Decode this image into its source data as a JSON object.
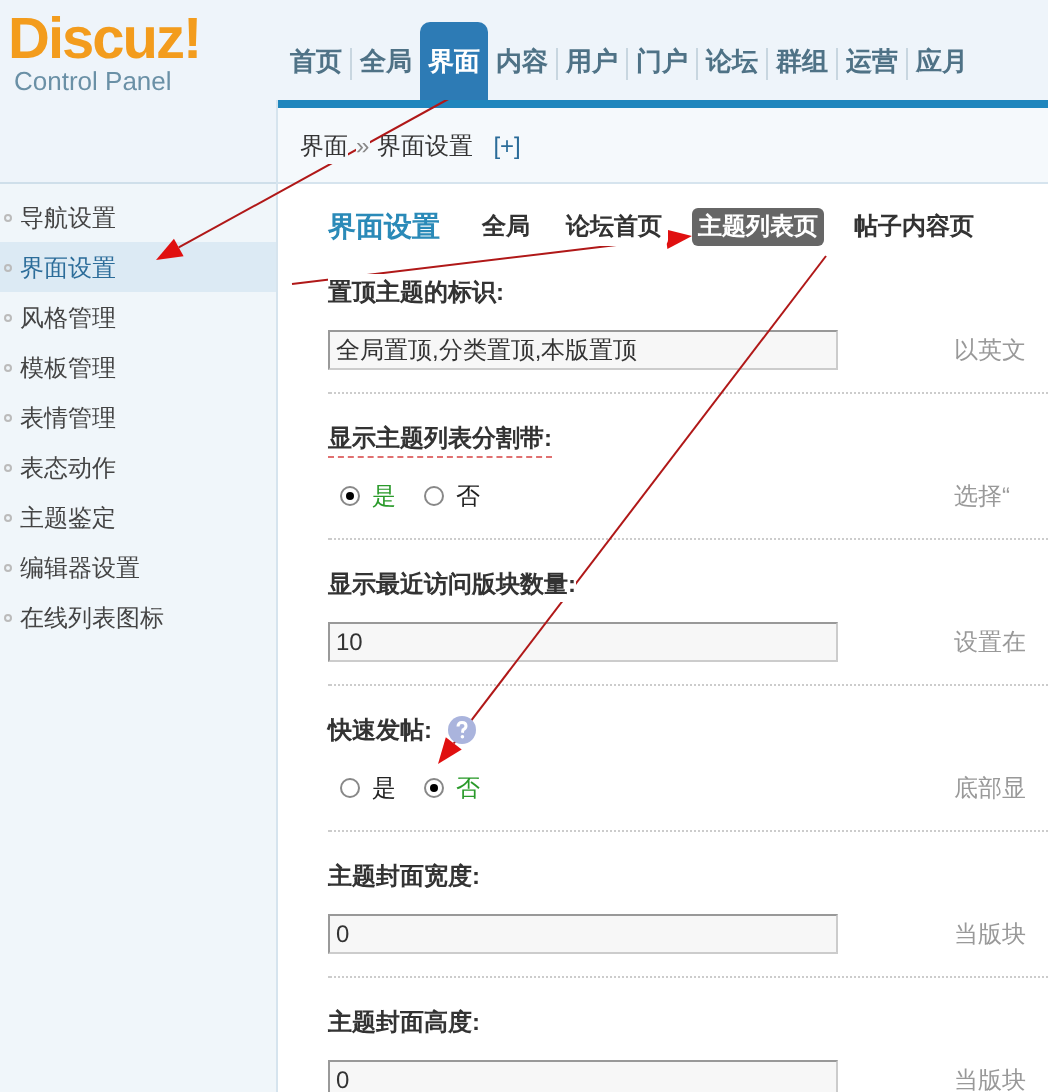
{
  "logo": {
    "name": "Discuz",
    "mark": "!",
    "subtitle": "Control Panel"
  },
  "nav": [
    {
      "label": "首页",
      "selected": false
    },
    {
      "label": "全局",
      "selected": false
    },
    {
      "label": "界面",
      "selected": true
    },
    {
      "label": "内容",
      "selected": false
    },
    {
      "label": "用户",
      "selected": false
    },
    {
      "label": "门户",
      "selected": false
    },
    {
      "label": "论坛",
      "selected": false
    },
    {
      "label": "群组",
      "selected": false
    },
    {
      "label": "运营",
      "selected": false
    },
    {
      "label": "应月",
      "selected": false
    }
  ],
  "breadcrumb": {
    "parent": "界面",
    "separator": "»",
    "current": "界面设置",
    "toggle": "[+]"
  },
  "sidebar": [
    {
      "label": "导航设置",
      "selected": false
    },
    {
      "label": "界面设置",
      "selected": true
    },
    {
      "label": "风格管理",
      "selected": false
    },
    {
      "label": "模板管理",
      "selected": false
    },
    {
      "label": "表情管理",
      "selected": false
    },
    {
      "label": "表态动作",
      "selected": false
    },
    {
      "label": "主题鉴定",
      "selected": false
    },
    {
      "label": "编辑器设置",
      "selected": false
    },
    {
      "label": "在线列表图标",
      "selected": false
    }
  ],
  "page_title": "界面设置",
  "tabs": [
    {
      "label": "全局",
      "selected": false
    },
    {
      "label": "论坛首页",
      "selected": false
    },
    {
      "label": "主题列表页",
      "selected": true
    },
    {
      "label": "帖子内容页",
      "selected": false
    }
  ],
  "settings": [
    {
      "kind": "text",
      "label": "置顶主题的标识:",
      "value": "全局置顶,分类置顶,本版置顶",
      "hint": "以英文"
    },
    {
      "kind": "radio",
      "label": "显示主题列表分割带:",
      "tip": true,
      "options": [
        {
          "label": "是",
          "selected": true
        },
        {
          "label": "否",
          "selected": false
        }
      ],
      "hint": "选择“"
    },
    {
      "kind": "text",
      "label": "显示最近访问版块数量:",
      "value": "10",
      "hint": "设置在"
    },
    {
      "kind": "radio",
      "label": "快速发帖:",
      "help": true,
      "options": [
        {
          "label": "是",
          "selected": false
        },
        {
          "label": "否",
          "selected": true
        }
      ],
      "hint": "底部显"
    },
    {
      "kind": "text",
      "label": "主题封面宽度:",
      "value": "0",
      "hint": "当版块"
    },
    {
      "kind": "text",
      "label": "主题封面高度:",
      "value": "0",
      "hint": "当版块"
    }
  ],
  "annotations": [
    {
      "kind": "arrow"
    },
    {
      "kind": "arrow"
    },
    {
      "kind": "arrow"
    }
  ]
}
